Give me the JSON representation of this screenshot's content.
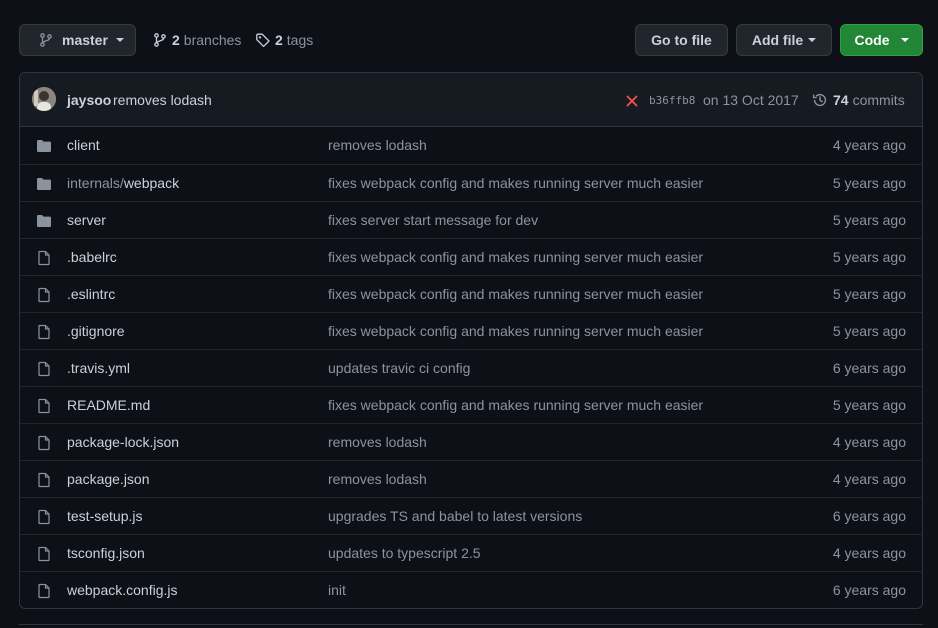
{
  "branch": {
    "name": "master"
  },
  "stats": {
    "branches_count": "2",
    "branches_label": "branches",
    "tags_count": "2",
    "tags_label": "tags"
  },
  "buttons": {
    "go_to_file": "Go to file",
    "add_file": "Add file",
    "code": "Code"
  },
  "commit": {
    "author": "jaysoo",
    "message": "removes lodash",
    "status_icon": "x-icon",
    "sha": "b36ffb8",
    "date": "on 13 Oct 2017",
    "count": "74",
    "count_label": "commits"
  },
  "files": [
    {
      "prefix": "",
      "name": "client",
      "type": "folder",
      "message": "removes lodash",
      "age": "4 years ago"
    },
    {
      "prefix": "internals/",
      "name": "webpack",
      "type": "folder",
      "message": "fixes webpack config and makes running server much easier",
      "age": "5 years ago"
    },
    {
      "prefix": "",
      "name": "server",
      "type": "folder",
      "message": "fixes server start message for dev",
      "age": "5 years ago"
    },
    {
      "prefix": "",
      "name": ".babelrc",
      "type": "file",
      "message": "fixes webpack config and makes running server much easier",
      "age": "5 years ago"
    },
    {
      "prefix": "",
      "name": ".eslintrc",
      "type": "file",
      "message": "fixes webpack config and makes running server much easier",
      "age": "5 years ago"
    },
    {
      "prefix": "",
      "name": ".gitignore",
      "type": "file",
      "message": "fixes webpack config and makes running server much easier",
      "age": "5 years ago"
    },
    {
      "prefix": "",
      "name": ".travis.yml",
      "type": "file",
      "message": "updates travic ci config",
      "age": "6 years ago"
    },
    {
      "prefix": "",
      "name": "README.md",
      "type": "file",
      "message": "fixes webpack config and makes running server much easier",
      "age": "5 years ago"
    },
    {
      "prefix": "",
      "name": "package-lock.json",
      "type": "file",
      "message": "removes lodash",
      "age": "4 years ago"
    },
    {
      "prefix": "",
      "name": "package.json",
      "type": "file",
      "message": "removes lodash",
      "age": "4 years ago"
    },
    {
      "prefix": "",
      "name": "test-setup.js",
      "type": "file",
      "message": "upgrades TS and babel to latest versions",
      "age": "6 years ago"
    },
    {
      "prefix": "",
      "name": "tsconfig.json",
      "type": "file",
      "message": "updates to typescript 2.5",
      "age": "4 years ago"
    },
    {
      "prefix": "",
      "name": "webpack.config.js",
      "type": "file",
      "message": "init",
      "age": "6 years ago"
    }
  ],
  "colors": {
    "code_button": "#238636",
    "status_fail": "#f85149",
    "accent": "#58a6ff"
  }
}
